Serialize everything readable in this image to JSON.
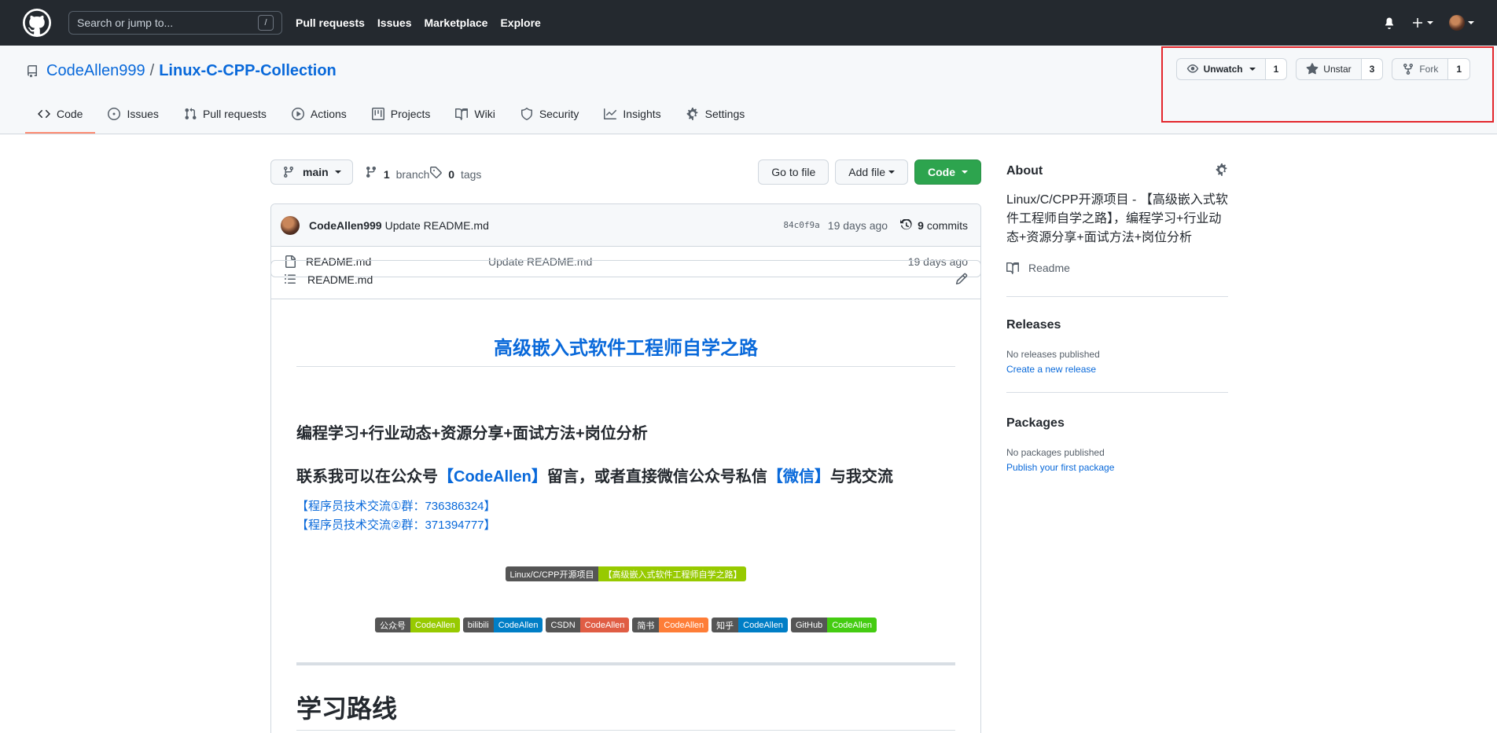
{
  "header": {
    "search_placeholder": "Search or jump to...",
    "search_key": "/",
    "nav": [
      "Pull requests",
      "Issues",
      "Marketplace",
      "Explore"
    ]
  },
  "repo": {
    "owner": "CodeAllen999",
    "separator": "/",
    "name": "Linux-C-CPP-Collection",
    "watch_label": "Unwatch",
    "watch_count": "1",
    "star_label": "Unstar",
    "star_count": "3",
    "fork_label": "Fork",
    "fork_count": "1",
    "tabs": [
      {
        "label": "Code",
        "icon": "code-icon"
      },
      {
        "label": "Issues",
        "icon": "issue-icon"
      },
      {
        "label": "Pull requests",
        "icon": "pull-request-icon"
      },
      {
        "label": "Actions",
        "icon": "play-icon"
      },
      {
        "label": "Projects",
        "icon": "project-icon"
      },
      {
        "label": "Wiki",
        "icon": "book-icon"
      },
      {
        "label": "Security",
        "icon": "shield-icon"
      },
      {
        "label": "Insights",
        "icon": "graph-icon"
      },
      {
        "label": "Settings",
        "icon": "gear-icon"
      }
    ]
  },
  "filenav": {
    "branch": "main",
    "branch_count": "1",
    "branch_label": "branch",
    "tag_count": "0",
    "tag_label": "tags",
    "goto_file": "Go to file",
    "add_file": "Add file",
    "code": "Code"
  },
  "commit": {
    "author": "CodeAllen999",
    "message": "Update README.md",
    "sha": "84c0f9a",
    "date": "19 days ago",
    "count": "9",
    "count_label": "commits"
  },
  "files": [
    {
      "name": "README.md",
      "message": "Update README.md",
      "date": "19 days ago"
    }
  ],
  "readme": {
    "title": "README.md",
    "h1": "高级嵌入式软件工程师自学之路",
    "h2": "编程学习+行业动态+资源分享+面试方法+岗位分析",
    "contact_pre": "联系我可以在公众号",
    "contact_link1": "【CodeAllen】",
    "contact_mid": "留言，或者直接微信公众号私信",
    "contact_link2": "【微信】",
    "contact_post": "与我交流",
    "group1": "【程序员技术交流①群：736386324】",
    "group2": "【程序员技术交流②群：371394777】",
    "main_badge": {
      "left": "Linux/C/CPP开源项目",
      "right": "【高级嵌入式软件工程师自学之路】",
      "color": "#97ca00"
    },
    "badges": [
      {
        "left": "公众号",
        "right": "CodeAllen",
        "color": "#97ca00"
      },
      {
        "left": "bilibili",
        "right": "CodeAllen",
        "color": "#007ec6"
      },
      {
        "left": "CSDN",
        "right": "CodeAllen",
        "color": "#e05d44"
      },
      {
        "left": "简书",
        "right": "CodeAllen",
        "color": "#fe7d37"
      },
      {
        "left": "知乎",
        "right": "CodeAllen",
        "color": "#007ec6"
      },
      {
        "left": "GitHub",
        "right": "CodeAllen",
        "color": "#4c1"
      }
    ],
    "h1b": "学习路线"
  },
  "sidebar": {
    "about": "About",
    "description": "Linux/C/CPP开源项目 - 【高级嵌入式软件工程师自学之路】，编程学习+行业动态+资源分享+面试方法+岗位分析",
    "readme": "Readme",
    "releases": "Releases",
    "no_releases": "No releases published",
    "create_release": "Create a new release",
    "packages": "Packages",
    "no_packages": "No packages published",
    "publish_package": "Publish your first package"
  }
}
